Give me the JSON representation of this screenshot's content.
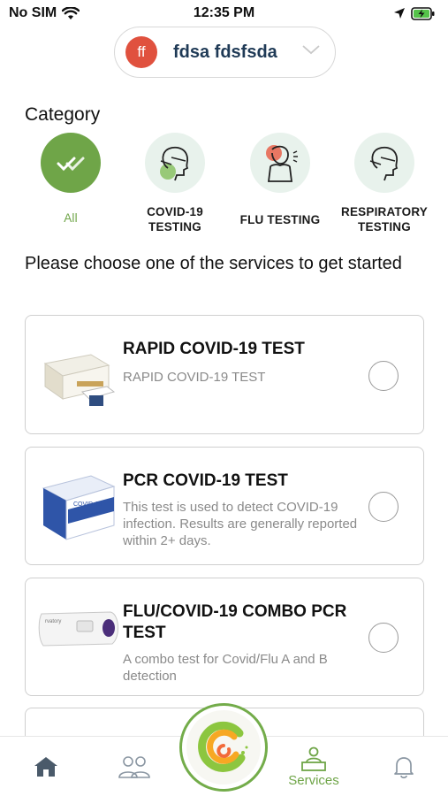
{
  "status_bar": {
    "carrier": "No SIM",
    "time": "12:35 PM"
  },
  "user": {
    "initials": "ff",
    "name": "fdsa fdsfsda"
  },
  "category": {
    "title": "Category",
    "items": [
      {
        "label": "All",
        "active": true
      },
      {
        "label_lines": [
          "COVID-19",
          "TESTING"
        ]
      },
      {
        "label": "FLU TESTING"
      },
      {
        "label_lines": [
          "RESPIRATORY",
          "TESTING"
        ]
      }
    ]
  },
  "prompt": "Please choose one of the services to get started",
  "services": [
    {
      "title": "RAPID COVID-19 TEST",
      "description": "RAPID COVID-19 TEST"
    },
    {
      "title": "PCR COVID-19 TEST",
      "description": "This test is used to detect COVID-19 infection. Results are generally reported within 2+ days."
    },
    {
      "title": "FLU/COVID-19 COMBO PCR TEST",
      "description": "A combo test for Covid/Flu A and B detection"
    }
  ],
  "bottom_nav": {
    "items": [
      {
        "icon": "home-icon"
      },
      {
        "icon": "people-icon"
      },
      {
        "icon": "services-icon",
        "label": "Services",
        "active": true
      },
      {
        "icon": "bell-icon"
      }
    ]
  },
  "colors": {
    "accent_green": "#6fa548",
    "avatar_red": "#e0513e",
    "mint": "#e8f2ec"
  }
}
